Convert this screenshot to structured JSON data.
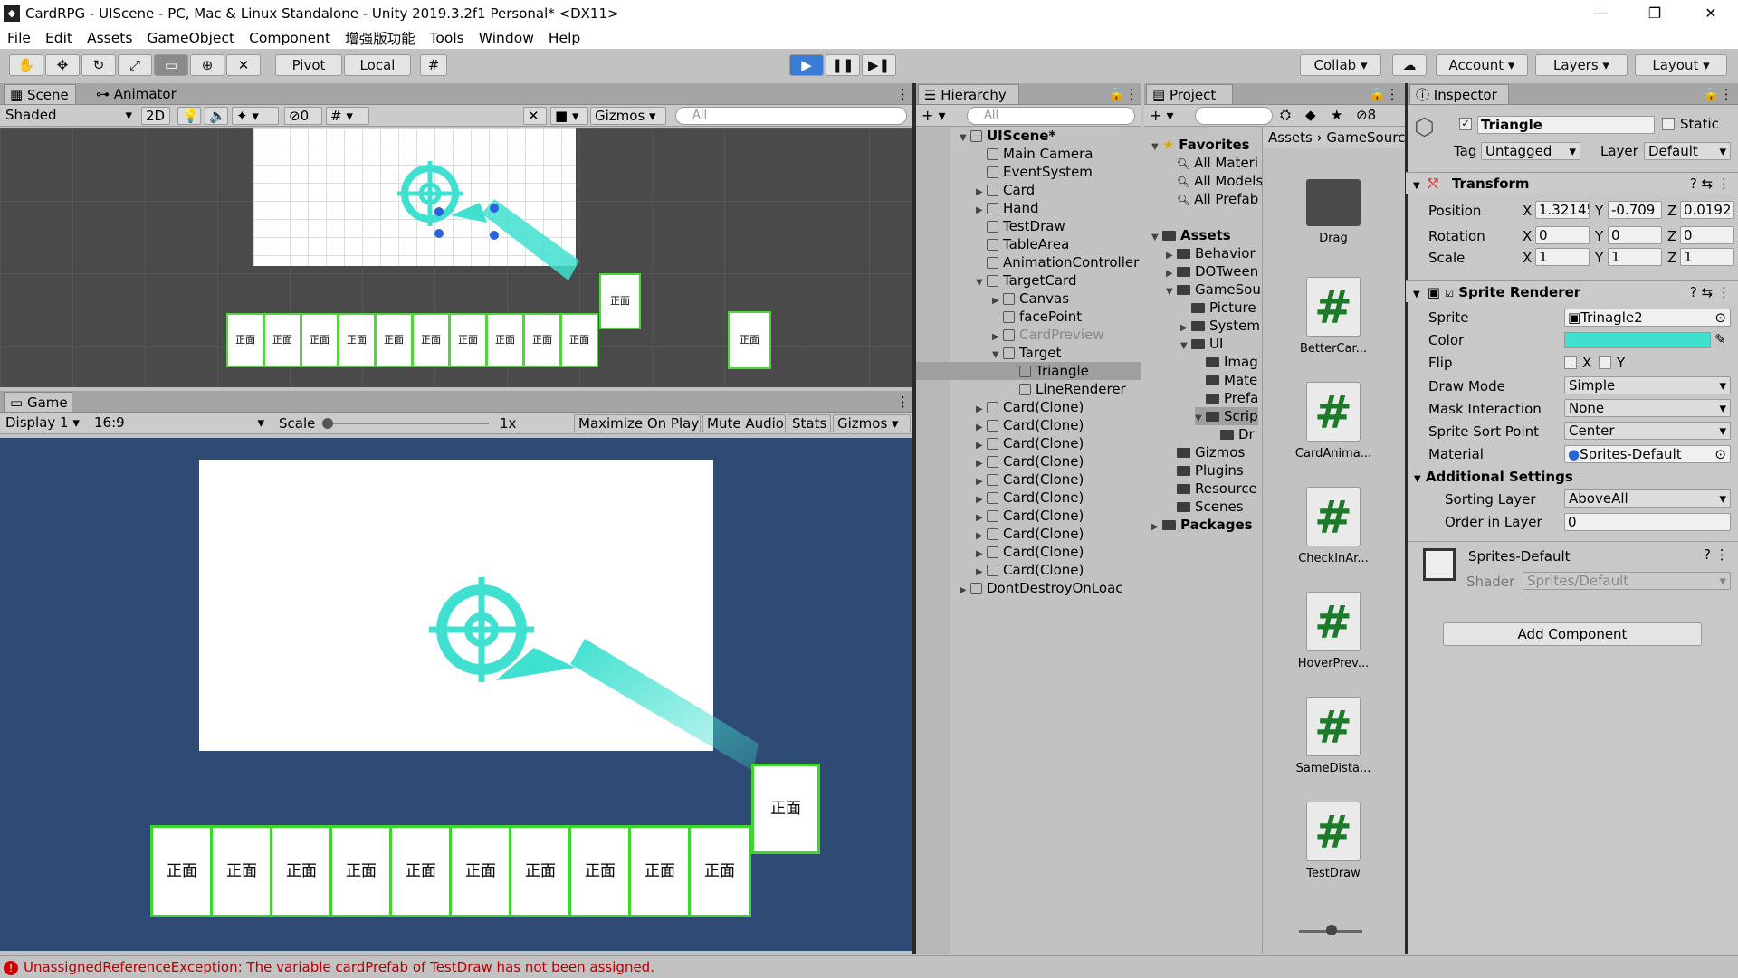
{
  "window": {
    "title": "CardRPG - UIScene - PC, Mac & Linux Standalone - Unity 2019.3.2f1 Personal* <DX11>",
    "min": "—",
    "max": "❐",
    "close": "✕"
  },
  "menu": [
    "File",
    "Edit",
    "Assets",
    "GameObject",
    "Component",
    "增强版功能",
    "Tools",
    "Window",
    "Help"
  ],
  "toolbar": {
    "pivot": "Pivot",
    "local": "Local",
    "collab": "Collab",
    "account": "Account",
    "layers": "Layers",
    "layout": "Layout"
  },
  "scene": {
    "tab": "Scene",
    "tab2": "Animator",
    "shading": "Shaded",
    "mode2d": "2D",
    "hidden_count": "0",
    "gizmos": "Gizmos",
    "search": "All"
  },
  "game": {
    "tab": "Game",
    "display": "Display 1",
    "aspect": "16:9",
    "scale_label": "Scale",
    "scale_value": "1x",
    "maximize": "Maximize On Play",
    "mute": "Mute Audio",
    "stats": "Stats",
    "gizmos": "Gizmos"
  },
  "card_label": "正面",
  "hierarchy": {
    "tab": "Hierarchy",
    "search": "All",
    "rows": [
      {
        "t": "UIScene*",
        "d": 0,
        "bold": true,
        "arrow": "▼",
        "ic": "scene"
      },
      {
        "t": "Main Camera",
        "d": 1
      },
      {
        "t": "EventSystem",
        "d": 1
      },
      {
        "t": "Card",
        "d": 1,
        "arrow": "▶"
      },
      {
        "t": "Hand",
        "d": 1,
        "arrow": "▶"
      },
      {
        "t": "TestDraw",
        "d": 1
      },
      {
        "t": "TableArea",
        "d": 1
      },
      {
        "t": "AnimationController",
        "d": 1
      },
      {
        "t": "TargetCard",
        "d": 1,
        "arrow": "▼"
      },
      {
        "t": "Canvas",
        "d": 2,
        "arrow": "▶"
      },
      {
        "t": "facePoint",
        "d": 2
      },
      {
        "t": "CardPreview",
        "d": 2,
        "arrow": "▶",
        "dim": true
      },
      {
        "t": "Target",
        "d": 2,
        "arrow": "▼"
      },
      {
        "t": "Triangle",
        "d": 3,
        "sel": true
      },
      {
        "t": "LineRenderer",
        "d": 3
      },
      {
        "t": "Card(Clone)",
        "d": 1,
        "arrow": "▶"
      },
      {
        "t": "Card(Clone)",
        "d": 1,
        "arrow": "▶"
      },
      {
        "t": "Card(Clone)",
        "d": 1,
        "arrow": "▶"
      },
      {
        "t": "Card(Clone)",
        "d": 1,
        "arrow": "▶"
      },
      {
        "t": "Card(Clone)",
        "d": 1,
        "arrow": "▶"
      },
      {
        "t": "Card(Clone)",
        "d": 1,
        "arrow": "▶"
      },
      {
        "t": "Card(Clone)",
        "d": 1,
        "arrow": "▶"
      },
      {
        "t": "Card(Clone)",
        "d": 1,
        "arrow": "▶"
      },
      {
        "t": "Card(Clone)",
        "d": 1,
        "arrow": "▶"
      },
      {
        "t": "Card(Clone)",
        "d": 1,
        "arrow": "▶"
      },
      {
        "t": "DontDestroyOnLoac",
        "d": 0,
        "arrow": "▶",
        "ic": "scene"
      }
    ]
  },
  "project": {
    "tab": "Project",
    "hidden_count": "8",
    "breadcrumb": [
      "Assets",
      "GameSourc"
    ],
    "tree": [
      {
        "t": "Favorites",
        "d": 0,
        "bold": true,
        "arrow": "▼",
        "ic": "star"
      },
      {
        "t": "All Materi",
        "d": 1,
        "ic": "search"
      },
      {
        "t": "All Models",
        "d": 1,
        "ic": "search"
      },
      {
        "t": "All Prefab",
        "d": 1,
        "ic": "search"
      },
      {
        "t": "",
        "d": 0
      },
      {
        "t": "Assets",
        "d": 0,
        "bold": true,
        "arrow": "▼",
        "ic": "folder"
      },
      {
        "t": "Behavior",
        "d": 1,
        "arrow": "▶",
        "ic": "folder"
      },
      {
        "t": "DOTween",
        "d": 1,
        "arrow": "▶",
        "ic": "folder"
      },
      {
        "t": "GameSou",
        "d": 1,
        "arrow": "▼",
        "ic": "folder"
      },
      {
        "t": "Picture",
        "d": 2,
        "ic": "folder"
      },
      {
        "t": "System",
        "d": 2,
        "arrow": "▶",
        "ic": "folder"
      },
      {
        "t": "UI",
        "d": 2,
        "arrow": "▼",
        "ic": "folder"
      },
      {
        "t": "Imag",
        "d": 3,
        "ic": "folder"
      },
      {
        "t": "Mate",
        "d": 3,
        "ic": "folder"
      },
      {
        "t": "Prefa",
        "d": 3,
        "ic": "folder"
      },
      {
        "t": "Scrip",
        "d": 3,
        "arrow": "▼",
        "ic": "folder",
        "sel": true
      },
      {
        "t": "Dr",
        "d": 4,
        "ic": "folder"
      },
      {
        "t": "Gizmos",
        "d": 1,
        "ic": "folder"
      },
      {
        "t": "Plugins",
        "d": 1,
        "ic": "folder"
      },
      {
        "t": "Resource",
        "d": 1,
        "ic": "folder"
      },
      {
        "t": "Scenes",
        "d": 1,
        "ic": "folder"
      },
      {
        "t": "Packages",
        "d": 0,
        "bold": true,
        "arrow": "▶",
        "ic": "folder"
      }
    ],
    "assets": [
      "Drag",
      "BetterCar...",
      "CardAnima...",
      "CheckInAr...",
      "HoverPrev...",
      "SameDista...",
      "TestDraw"
    ]
  },
  "inspector": {
    "tab": "Inspector",
    "name": "Triangle",
    "static": "Static",
    "tag_label": "Tag",
    "tag": "Untagged",
    "layer_label": "Layer",
    "layer": "Default",
    "transform": {
      "title": "Transform",
      "position": "Position",
      "rotation": "Rotation",
      "scale": "Scale",
      "pos": [
        "1.32145",
        "-0.709",
        "0.01921"
      ],
      "rot": [
        "0",
        "0",
        "0"
      ],
      "scl": [
        "1",
        "1",
        "1"
      ]
    },
    "sprite_renderer": {
      "title": "Sprite Renderer",
      "sprite_label": "Sprite",
      "sprite": "Trinagle2",
      "color_label": "Color",
      "color": "#40e0d0",
      "flip_label": "Flip",
      "flip_x": "X",
      "flip_y": "Y",
      "draw_mode_label": "Draw Mode",
      "draw_mode": "Simple",
      "mask_label": "Mask Interaction",
      "mask": "None",
      "sort_point_label": "Sprite Sort Point",
      "sort_point": "Center",
      "material_label": "Material",
      "material": "Sprites-Default",
      "additional": "Additional Settings",
      "sorting_layer_label": "Sorting Layer",
      "sorting_layer": "AboveAll",
      "order_label": "Order in Layer",
      "order": "0"
    },
    "material": {
      "name": "Sprites-Default",
      "shader_label": "Shader",
      "shader": "Sprites/Default"
    },
    "add_component": "Add Component"
  },
  "status": {
    "message": "UnassignedReferenceException: The variable cardPrefab of TestDraw has not been assigned."
  },
  "colors": {
    "accent": "#40e0d0",
    "card_border": "#3cd62e",
    "game_bg": "#2f4a74"
  }
}
